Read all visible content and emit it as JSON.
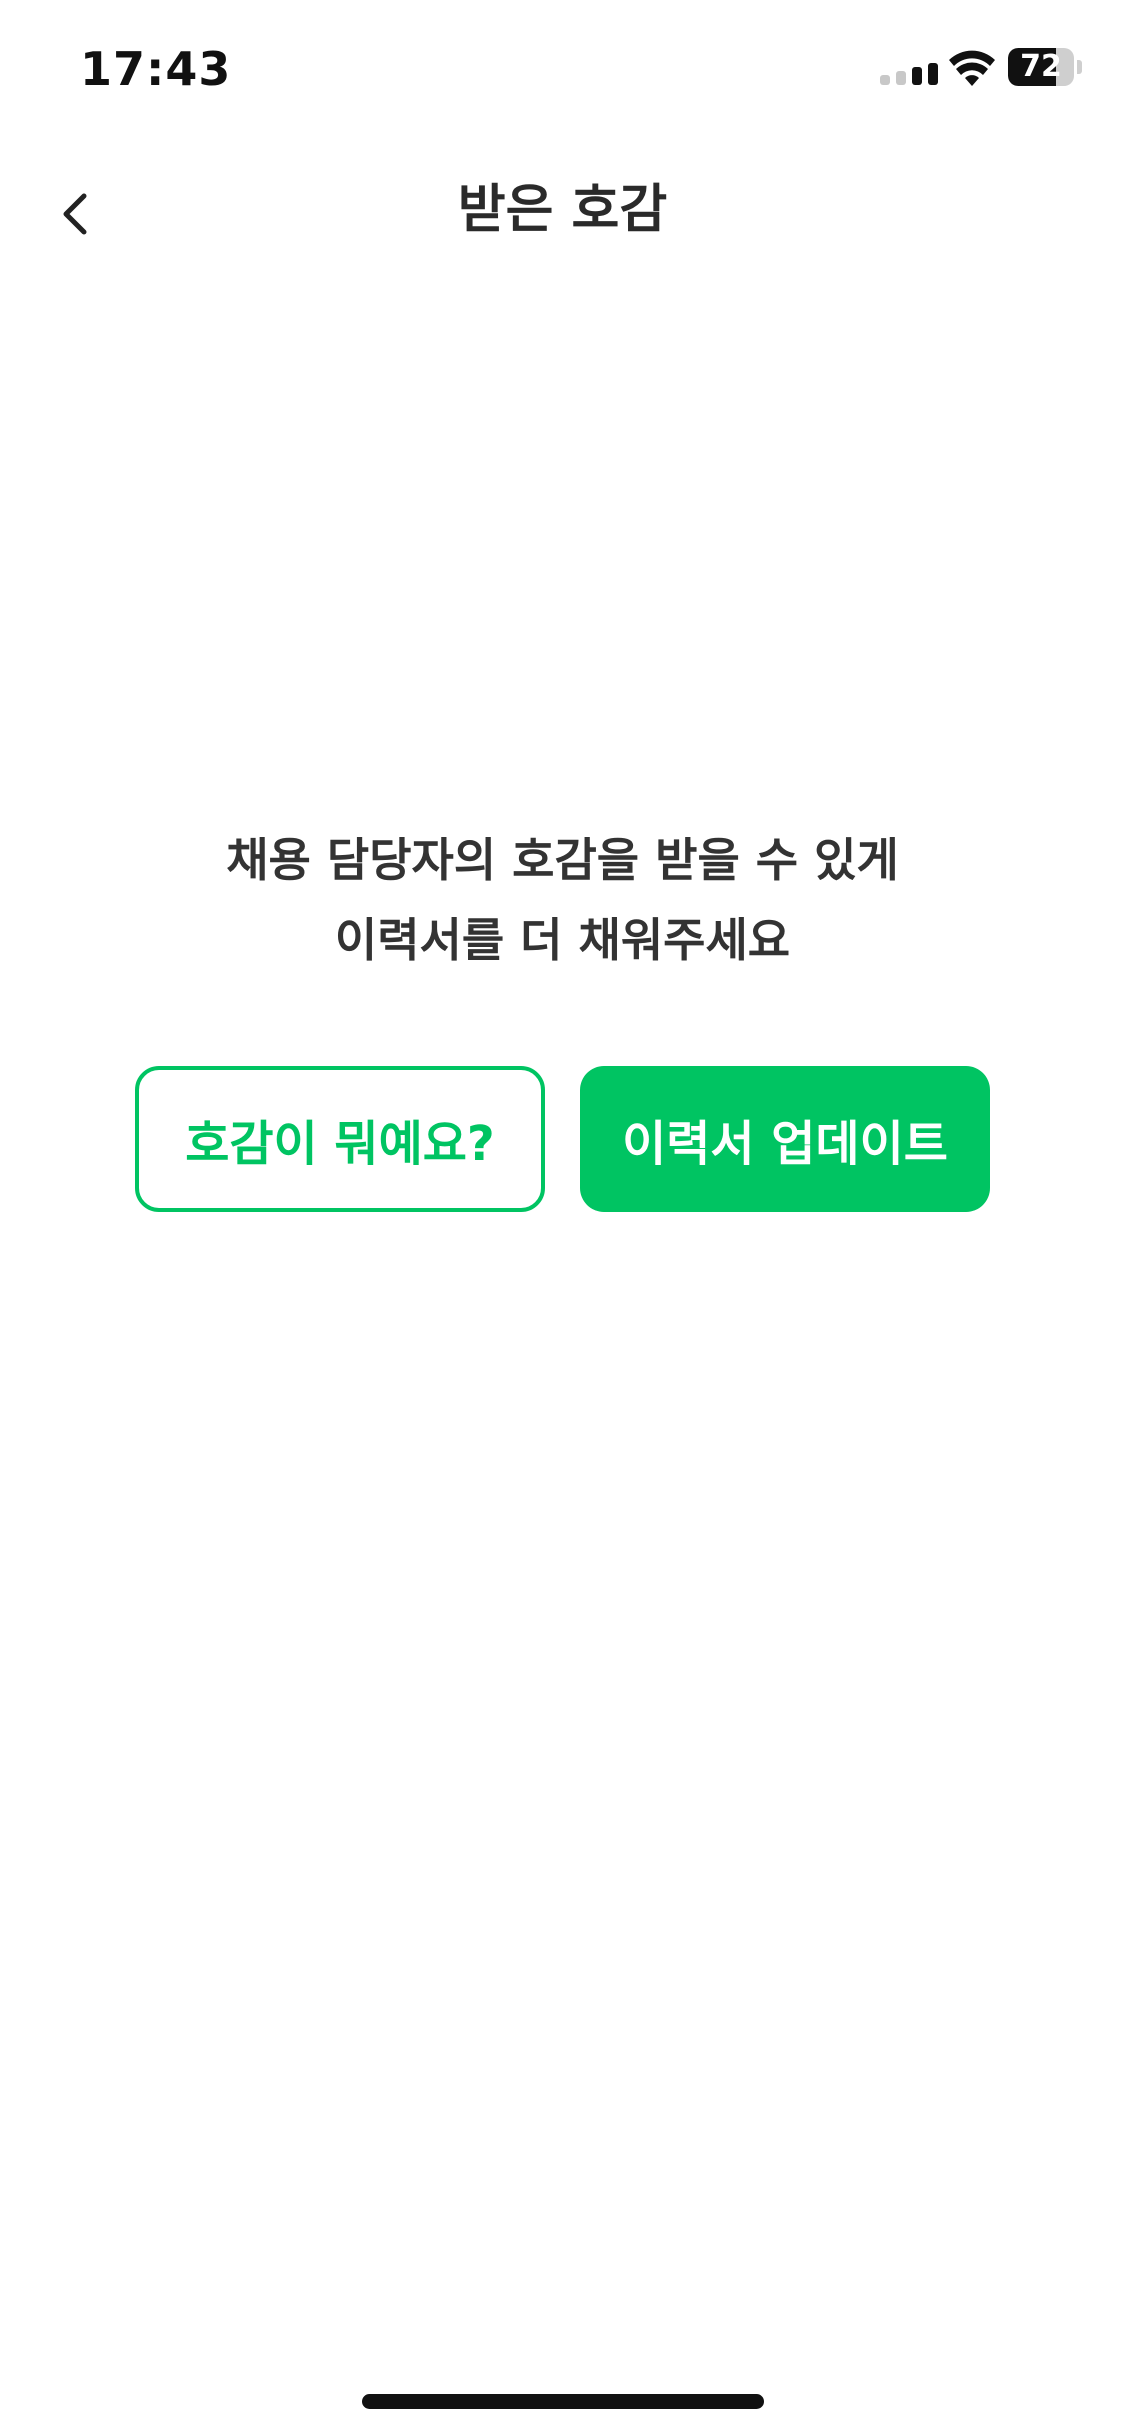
{
  "status_bar": {
    "time": "17:43",
    "battery_level": "72",
    "battery_fraction": 0.72,
    "icons": [
      "signal-icon",
      "wifi-icon",
      "battery-icon"
    ]
  },
  "nav": {
    "title": "받은 호감",
    "back_icon": "chevron-left-icon"
  },
  "empty_state": {
    "line1": "채용 담당자의 호감을 받을 수 있게",
    "line2": "이력서를 더 채워주세요"
  },
  "actions": {
    "what_is_like_label": "호감이 뭐예요?",
    "update_resume_label": "이력서 업데이트"
  },
  "colors": {
    "accent": "#00c462",
    "text": "#2a2a2a",
    "background": "#ffffff"
  }
}
